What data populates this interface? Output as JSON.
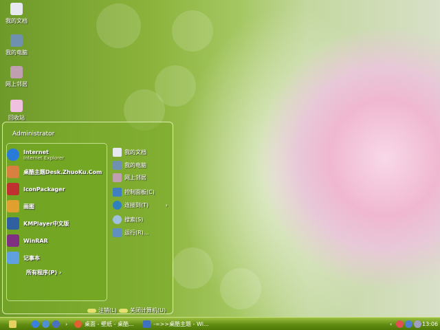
{
  "desktop": {
    "icons": [
      {
        "label": "我的文档",
        "icon": "my-documents-icon"
      },
      {
        "label": "我的电脑",
        "icon": "my-computer-icon"
      },
      {
        "label": "网上邻居",
        "icon": "network-places-icon"
      },
      {
        "label": "回收站",
        "icon": "recycle-bin-icon"
      }
    ]
  },
  "start_menu": {
    "user": "Administrator",
    "pinned": [
      {
        "title": "Internet",
        "subtitle": "Internet Explorer",
        "icon": "internet-explorer-icon",
        "color": "#2a7ad8"
      },
      {
        "title": "桌酷主题Desk.ZhuoKu.Com",
        "icon": "zhuoku-icon",
        "color": "#d88040"
      },
      {
        "title": "IconPackager",
        "icon": "iconpackager-icon",
        "color": "#c03030"
      },
      {
        "title": "画图",
        "icon": "paint-icon",
        "color": "#e0a030"
      },
      {
        "title": "KMPlayer中文版",
        "icon": "kmplayer-icon",
        "color": "#3060a0"
      },
      {
        "title": "WinRAR",
        "icon": "winrar-icon",
        "color": "#803080"
      },
      {
        "title": "记事本",
        "icon": "notepad-icon",
        "color": "#60a0e0"
      }
    ],
    "all_programs": "所有程序(P)",
    "right": [
      {
        "label": "我的文档",
        "icon": "my-documents-icon"
      },
      {
        "label": "我的电脑",
        "icon": "my-computer-icon"
      },
      {
        "label": "网上邻居",
        "icon": "network-places-icon"
      },
      {
        "label": "控制面板(C)",
        "icon": "control-panel-icon"
      },
      {
        "label": "连接到(T)",
        "icon": "connect-to-icon",
        "arrow": "›"
      },
      {
        "label": "搜索(S)",
        "icon": "search-icon"
      },
      {
        "label": "运行(R)...",
        "icon": "run-icon"
      }
    ],
    "logoff": "注销(L)",
    "shutdown": "关闭计算机(U)"
  },
  "taskbar": {
    "tasks": [
      {
        "label": "桌面 - 壁纸 - 桌酷..."
      },
      {
        "label": "-=>>桌酷主题 - Wi..."
      }
    ],
    "clock": "13:06"
  }
}
